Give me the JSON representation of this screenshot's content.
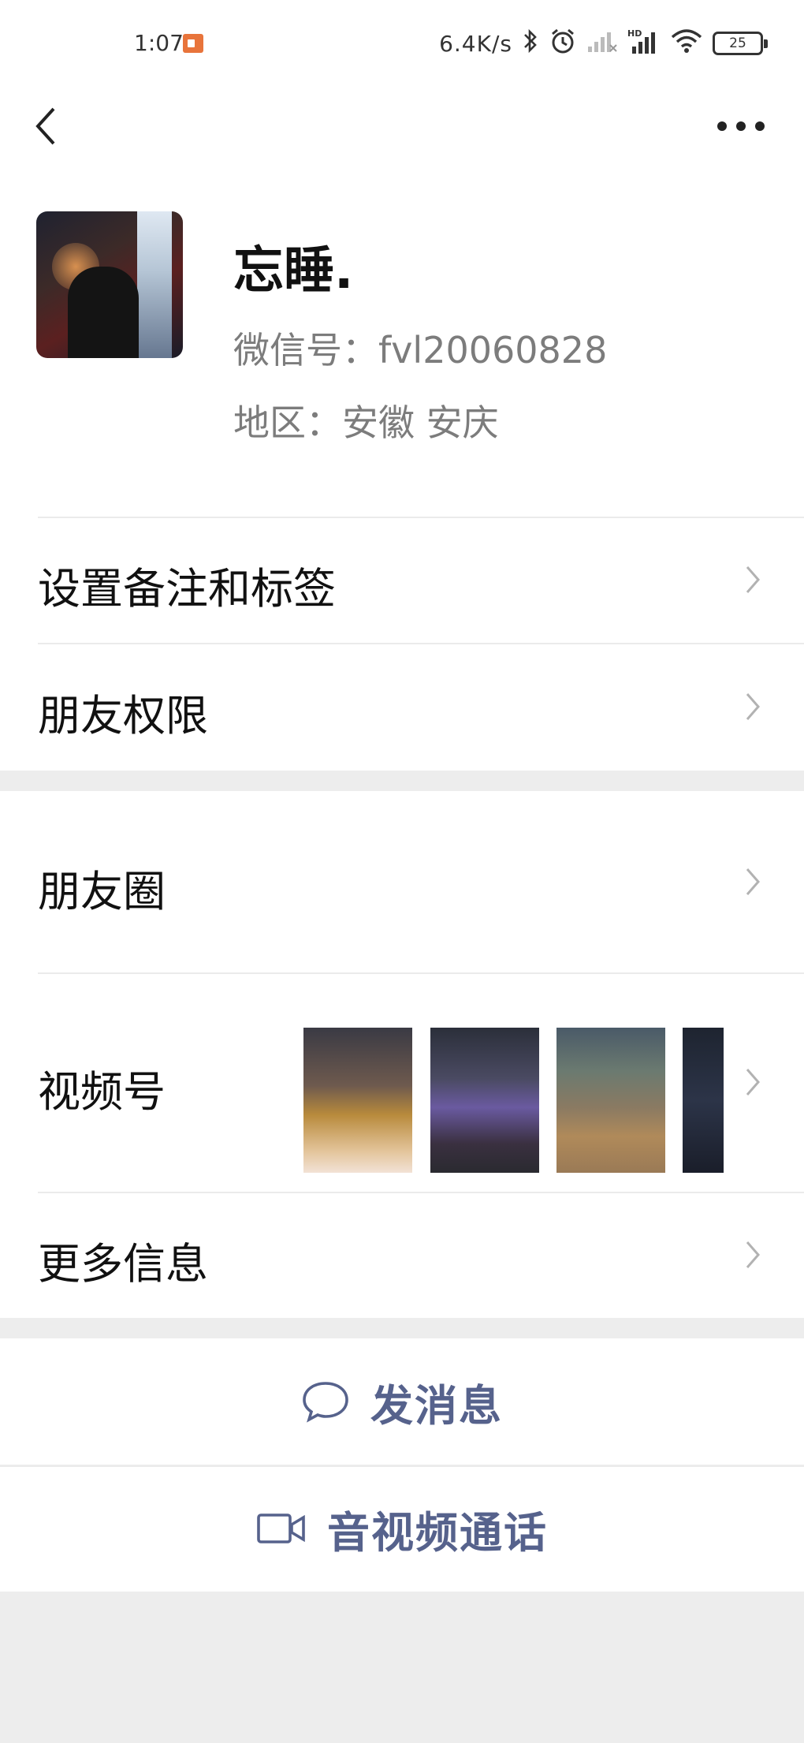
{
  "status_bar": {
    "time": "1:07",
    "net_speed": "6.4K/s",
    "battery": "25",
    "icons": [
      "screen-record-icon",
      "bluetooth-icon",
      "alarm-icon",
      "signal-icon",
      "hd-signal-icon",
      "wifi-icon",
      "battery-icon"
    ]
  },
  "nav": {
    "back_icon": "chevron-left-icon",
    "more_icon": "more-dots-icon"
  },
  "profile": {
    "nickname": "忘睡.",
    "wechat_id": "微信号：fvl20060828",
    "region": "地区：安徽  安庆"
  },
  "rows": {
    "remark_tags": "设置备注和标签",
    "friend_permissions": "朋友权限",
    "moments": "朋友圈",
    "channels": "视频号",
    "more_info": "更多信息"
  },
  "actions": {
    "send_message": "发消息",
    "video_call": "音视频通话"
  },
  "colors": {
    "accent": "#56628c",
    "background": "#ededed",
    "secondary_text": "#7c7c7c"
  }
}
